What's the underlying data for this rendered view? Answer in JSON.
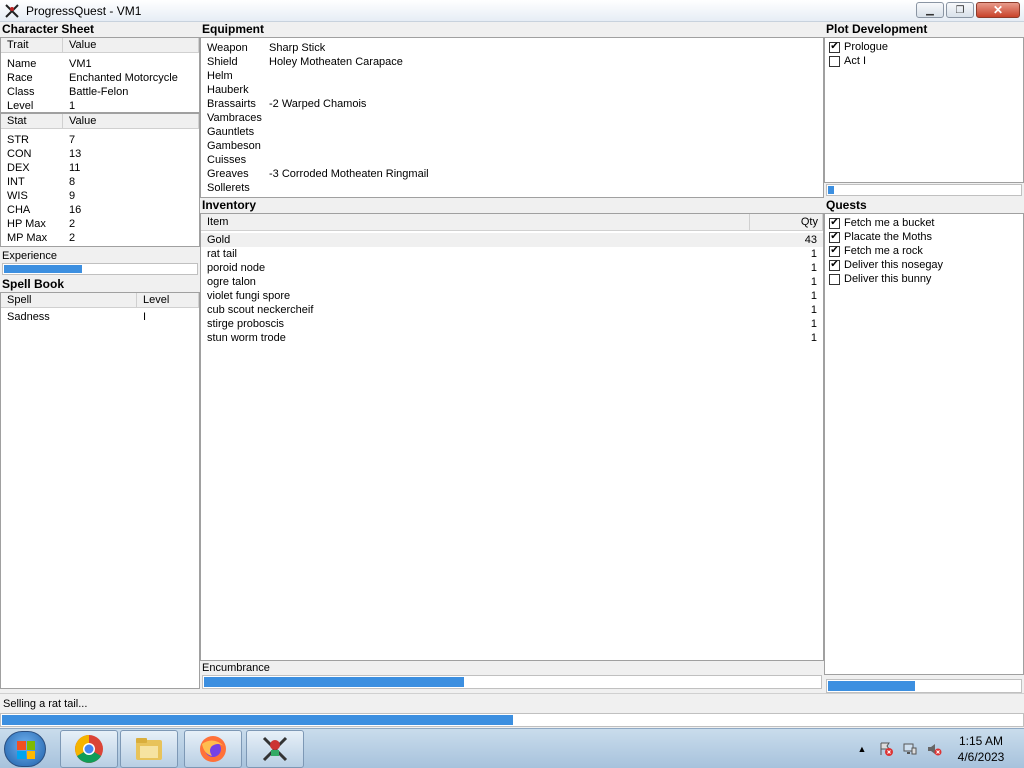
{
  "window": {
    "title": "ProgressQuest - VM1",
    "minimize": "▁",
    "restore": "❐",
    "close": "✕"
  },
  "character_sheet": {
    "title": "Character Sheet",
    "trait_header": "Trait",
    "value_header": "Value",
    "traits": [
      {
        "trait": "Name",
        "value": "VM1"
      },
      {
        "trait": "Race",
        "value": "Enchanted Motorcycle"
      },
      {
        "trait": "Class",
        "value": "Battle-Felon"
      },
      {
        "trait": "Level",
        "value": "1"
      }
    ],
    "stat_header": "Stat",
    "stat_value_header": "Value",
    "stats": [
      {
        "stat": "STR",
        "value": "7"
      },
      {
        "stat": "CON",
        "value": "13"
      },
      {
        "stat": "DEX",
        "value": "11"
      },
      {
        "stat": "INT",
        "value": "8"
      },
      {
        "stat": "WIS",
        "value": "9"
      },
      {
        "stat": "CHA",
        "value": "16"
      },
      {
        "stat": "HP Max",
        "value": "2"
      },
      {
        "stat": "MP Max",
        "value": "2"
      }
    ],
    "experience_label": "Experience",
    "experience_progress": 0.4
  },
  "spell_book": {
    "title": "Spell Book",
    "spell_header": "Spell",
    "level_header": "Level",
    "spells": [
      {
        "spell": "Sadness",
        "level": "I"
      }
    ]
  },
  "equipment": {
    "title": "Equipment",
    "items": [
      {
        "slot": "Weapon",
        "item": "Sharp Stick"
      },
      {
        "slot": "Shield",
        "item": "Holey Motheaten Carapace"
      },
      {
        "slot": "Helm",
        "item": ""
      },
      {
        "slot": "Hauberk",
        "item": ""
      },
      {
        "slot": "Brassairts",
        "item": "-2 Warped Chamois"
      },
      {
        "slot": "Vambraces",
        "item": ""
      },
      {
        "slot": "Gauntlets",
        "item": ""
      },
      {
        "slot": "Gambeson",
        "item": ""
      },
      {
        "slot": "Cuisses",
        "item": ""
      },
      {
        "slot": "Greaves",
        "item": "-3 Corroded Motheaten Ringmail"
      },
      {
        "slot": "Sollerets",
        "item": ""
      }
    ]
  },
  "inventory": {
    "title": "Inventory",
    "item_header": "Item",
    "qty_header": "Qty",
    "items": [
      {
        "item": "Gold",
        "qty": "43"
      },
      {
        "item": "rat tail",
        "qty": "1"
      },
      {
        "item": "poroid node",
        "qty": "1"
      },
      {
        "item": "ogre talon",
        "qty": "1"
      },
      {
        "item": "violet fungi spore",
        "qty": "1"
      },
      {
        "item": "cub scout neckercheif",
        "qty": "1"
      },
      {
        "item": "stirge proboscis",
        "qty": "1"
      },
      {
        "item": "stun worm trode",
        "qty": "1"
      }
    ],
    "encumbrance_label": "Encumbrance",
    "encumbrance_progress": 0.42
  },
  "plot": {
    "title": "Plot Development",
    "acts": [
      {
        "label": "Prologue",
        "checked": true
      },
      {
        "label": "Act I",
        "checked": false
      }
    ],
    "progress": 0.03
  },
  "quests": {
    "title": "Quests",
    "items": [
      {
        "label": "Fetch me a bucket",
        "checked": true
      },
      {
        "label": "Placate the Moths",
        "checked": true
      },
      {
        "label": "Fetch me a rock",
        "checked": true
      },
      {
        "label": "Deliver this nosegay",
        "checked": true
      },
      {
        "label": "Deliver this bunny",
        "checked": false
      }
    ],
    "progress": 0.45
  },
  "status": {
    "text": "Selling a rat tail...",
    "progress": 0.5
  },
  "taskbar": {
    "apps": [
      "chrome-icon",
      "file-explorer-icon",
      "firefox-icon",
      "progressquest-icon"
    ],
    "time": "1:15 AM",
    "date": "4/6/2023",
    "tray_arrow": "▲"
  },
  "colors": {
    "progress": "#3c8fe0",
    "taskbar": "#b9cfe4"
  }
}
